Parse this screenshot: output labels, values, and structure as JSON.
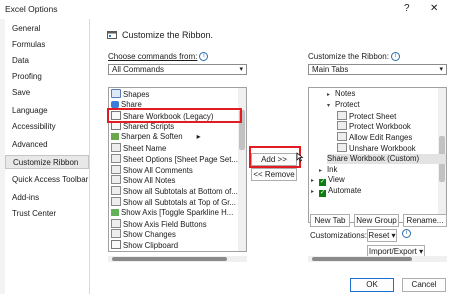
{
  "window": {
    "title": "Excel Options",
    "help": "?",
    "close": "✕"
  },
  "sidebar": {
    "items": [
      {
        "label": "General"
      },
      {
        "label": "Formulas"
      },
      {
        "label": "Data"
      },
      {
        "label": "Proofing"
      },
      {
        "label": "Save"
      },
      {
        "label": "Language"
      },
      {
        "label": "Accessibility"
      },
      {
        "label": "Advanced"
      },
      {
        "label": "Customize Ribbon",
        "selected": true
      },
      {
        "label": "Quick Access Toolbar"
      },
      {
        "label": "Add-ins"
      },
      {
        "label": "Trust Center"
      }
    ]
  },
  "main": {
    "heading": "Customize the Ribbon.",
    "choose_label": "Choose commands from:",
    "choose_value": "All Commands",
    "customize_label": "Customize the Ribbon:",
    "customize_value": "Main Tabs",
    "commands": [
      {
        "label": "Shapes",
        "icon": "shapes-icon"
      },
      {
        "label": "Share",
        "icon": "share-icon"
      },
      {
        "label": "Share Workbook (Legacy)",
        "icon": "share-workbook-icon",
        "highlighted": true
      },
      {
        "label": "Shared Scripts",
        "icon": "scripts-icon"
      },
      {
        "label": "Sharpen & Soften",
        "icon": "sharpen-icon",
        "arrow": "▸"
      },
      {
        "label": "Sheet Name",
        "icon": "sheet-name-icon"
      },
      {
        "label": "Sheet Options [Sheet Page Set...",
        "icon": "sheet-options-icon"
      },
      {
        "label": "Show All Comments",
        "icon": "comments-icon"
      },
      {
        "label": "Show All Notes",
        "icon": "notes-icon"
      },
      {
        "label": "Show all Subtotals at Bottom of...",
        "icon": "subtotal-icon"
      },
      {
        "label": "Show all Subtotals at Top of Gr...",
        "icon": "subtotal-icon"
      },
      {
        "label": "Show Axis [Toggle Sparkline H...",
        "icon": "axis-icon"
      },
      {
        "label": "Show Axis Field Buttons",
        "icon": "axis-field-icon"
      },
      {
        "label": "Show Changes",
        "icon": "changes-icon"
      },
      {
        "label": "Show Clipboard",
        "icon": "clipboard-icon"
      }
    ],
    "tabs_tree": [
      {
        "label": "Notes",
        "level": 2,
        "type": "expander",
        "arrow": "▸"
      },
      {
        "label": "Protect",
        "level": 2,
        "type": "expander-open",
        "arrow": "▾"
      },
      {
        "label": "Protect Sheet",
        "level": 3,
        "type": "item"
      },
      {
        "label": "Protect Workbook",
        "level": 3,
        "type": "item"
      },
      {
        "label": "Allow Edit Ranges",
        "level": 3,
        "type": "item"
      },
      {
        "label": "Unshare Workbook",
        "level": 3,
        "type": "item"
      },
      {
        "label": "Share Workbook (Custom)",
        "level": 2,
        "type": "selected"
      },
      {
        "label": "Ink",
        "level": 1,
        "type": "expander",
        "arrow": "▸"
      },
      {
        "label": "View",
        "level": 0,
        "type": "checked",
        "arrow": "▸"
      },
      {
        "label": "Automate",
        "level": 0,
        "type": "checked",
        "arrow": "▸"
      }
    ],
    "add_button": "Add >>",
    "remove_button": "<< Remove",
    "new_tab": "New Tab",
    "new_group": "New Group",
    "rename": "Rename...",
    "customizations_label": "Customizations:",
    "reset": "Reset ▾",
    "import_export": "Import/Export ▾",
    "ok": "OK",
    "cancel": "Cancel"
  }
}
